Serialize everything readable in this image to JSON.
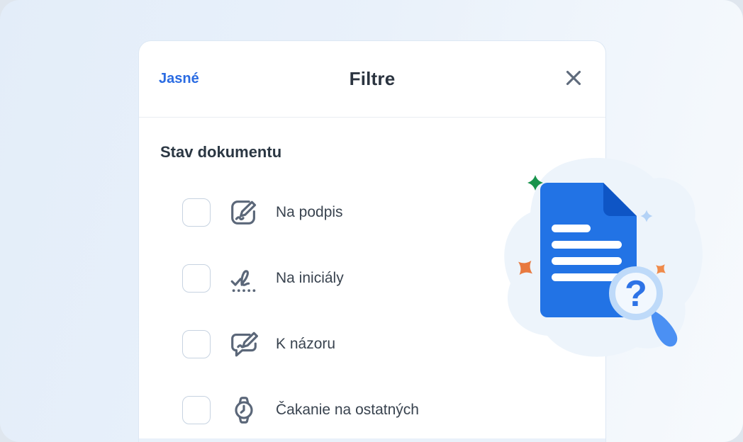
{
  "header": {
    "clear_label": "Jasné",
    "title": "Filtre",
    "close_icon": "close-x-icon"
  },
  "filters": {
    "section_title": "Stav dokumentu",
    "items": [
      {
        "label": "Na podpis",
        "icon": "sign-document-icon",
        "checked": false
      },
      {
        "label": "Na iniciály",
        "icon": "initials-signature-icon",
        "checked": false
      },
      {
        "label": "K názoru",
        "icon": "comment-pen-icon",
        "checked": false
      },
      {
        "label": "Čakanie na ostatných",
        "icon": "watch-icon",
        "checked": false
      }
    ]
  },
  "illustration": {
    "description": "blue document with magnifying glass and question mark, decorative sparkles",
    "icons": [
      "document-icon",
      "magnifier-question-icon",
      "sparkle-icons"
    ]
  },
  "colors": {
    "accent_blue": "#2a6be2",
    "title_dark": "#2b3440",
    "label_dark": "#39434f",
    "icon_slate": "#5b6779",
    "checkbox_border": "#c7d3e1",
    "card_border": "#dde8f4",
    "background_left": "#e3edf9",
    "background_right": "#f7fafd",
    "doc_blue": "#2273e5",
    "doc_fold_blue": "#0e55c5",
    "magnifier_ring": "#bedaf9",
    "magnifier_handle": "#4b90f3",
    "sparkle_green": "#17934c",
    "sparkle_orange": "#e8793f",
    "sparkle_light_blue": "#b3d2f6"
  }
}
